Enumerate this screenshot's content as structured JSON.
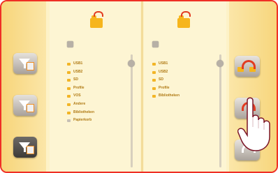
{
  "left_panel": {
    "items": [
      {
        "label": "USB1",
        "icon": "folder-icon"
      },
      {
        "label": "USB2",
        "icon": "folder-icon"
      },
      {
        "label": "SD",
        "icon": "folder-icon"
      },
      {
        "label": "Profile",
        "icon": "folder-icon"
      },
      {
        "label": "VOS",
        "icon": "folder-icon"
      },
      {
        "label": "Andere",
        "icon": "folder-icon"
      },
      {
        "label": "Bibliotheken",
        "icon": "folder-icon"
      },
      {
        "label": "Papierkorb",
        "icon": "document-icon"
      }
    ]
  },
  "right_panel": {
    "items": [
      {
        "label": "USB1",
        "icon": "folder-icon"
      },
      {
        "label": "USB2",
        "icon": "folder-icon"
      },
      {
        "label": "SD",
        "icon": "folder-icon"
      },
      {
        "label": "Profile",
        "icon": "folder-icon"
      },
      {
        "label": "Bibliotheken",
        "icon": "folder-icon"
      }
    ]
  },
  "colors": {
    "frame_border": "#ef2f25",
    "panel_background": "#fdf5d3",
    "side_background": "#f7d57a",
    "folder_orange": "#f6b51c",
    "accent_red": "#e23b20"
  }
}
